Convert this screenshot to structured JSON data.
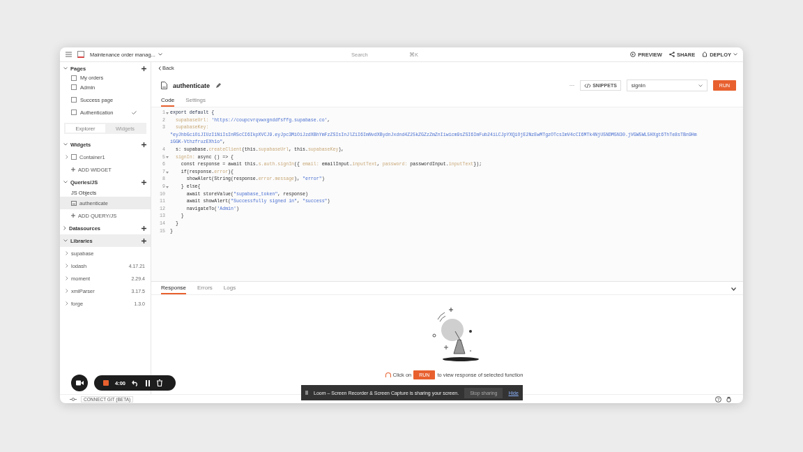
{
  "header": {
    "app_name": "Maintenance order manag...",
    "search_placeholder": "Search",
    "search_shortcut": "⌘K",
    "actions": [
      {
        "label": "PREVIEW",
        "kind": "preview"
      },
      {
        "label": "SHARE",
        "kind": "share"
      },
      {
        "label": "DEPLOY",
        "kind": "deploy"
      }
    ]
  },
  "sidebar": {
    "pages_title": "Pages",
    "pages": [
      {
        "label": "My orders",
        "checked": false
      },
      {
        "label": "Admin",
        "checked": false
      },
      {
        "label": "Success page",
        "checked": false
      },
      {
        "label": "Authentication",
        "checked": true
      }
    ],
    "toggle": [
      {
        "label": "Explorer",
        "selected": true
      },
      {
        "label": "Widgets",
        "selected": false
      }
    ],
    "sections": [
      {
        "title": "Widgets",
        "expanded": true,
        "hovered": false,
        "items": [
          {
            "label": "Container1",
            "kind": "widget",
            "selected": false
          },
          {
            "label": "ADD WIDGET",
            "kind": "add",
            "selected": false
          }
        ]
      },
      {
        "title": "Queries/JS",
        "expanded": true,
        "hovered": false,
        "items": [
          {
            "label": "JS Objects",
            "kind": "group",
            "selected": false
          },
          {
            "label": "authenticate",
            "kind": "js",
            "selected": true
          },
          {
            "label": "ADD QUERY/JS",
            "kind": "add",
            "selected": false
          }
        ]
      },
      {
        "title": "Datasources",
        "expanded": false,
        "hovered": false
      },
      {
        "title": "Libraries",
        "expanded": true,
        "hovered": true,
        "items": [
          {
            "label": "supabase",
            "kind": "lib",
            "selected": false
          },
          {
            "label": "lodash",
            "version": "4.17.21",
            "kind": "lib",
            "selected": false
          },
          {
            "label": "moment",
            "version": "2.29.4",
            "kind": "lib",
            "selected": false
          },
          {
            "label": "xmlParser",
            "version": "3.17.5",
            "kind": "lib",
            "selected": false
          },
          {
            "label": "forge",
            "version": "1.3.0",
            "kind": "lib",
            "selected": false
          }
        ]
      }
    ]
  },
  "editor": {
    "back": "Back",
    "name": "authenticate",
    "more": "···",
    "snippets": "SNIPPETS",
    "function": "signIn",
    "run": "RUN",
    "tabs": [
      {
        "label": "Code",
        "selected": true
      },
      {
        "label": "Settings",
        "selected": false
      }
    ],
    "lines": [
      {
        "no": "1",
        "fold": true,
        "segments": [
          {
            "text": "export default {",
            "kind": "keyword"
          }
        ]
      },
      {
        "no": "2",
        "fold": false,
        "segments": [
          {
            "text": "  supabaseUrl: ",
            "kind": "prop"
          },
          {
            "text": "'https://coupcvrqvwxgnddfsffg.supabase.co'",
            "kind": "string"
          },
          {
            "text": ",",
            "kind": "plain"
          }
        ]
      },
      {
        "no": "3",
        "fold": false,
        "segments": [
          {
            "text": "  supabaseKey:",
            "kind": "prop"
          }
        ]
      },
      {
        "fold": false,
        "segments": [
          {
            "text": "\"eyJhbGciOiJIUzI1NiIsInR5cCI6IkpXVCJ9.eyJpc3MiOiJzdXBhYmFzZSIsInJlZiI6ImNvdXBydnJxdnd4Z25kZGZzZmZnIiwicm9sZSI6ImFub24iLCJpYXQiOjE2NzEwMTgzOTcsImV4cCI6MTk4NjU5NDM5N30.jVGW5WL5HXgt6ThTe8sTBn9Hm",
            "kind": "string"
          }
        ]
      },
      {
        "fold": false,
        "segments": [
          {
            "text": "iGGK-VthzfruzEXh1o\"",
            "kind": "string"
          },
          {
            "text": ",",
            "kind": "plain"
          }
        ]
      },
      {
        "no": "4",
        "fold": false,
        "segments": [
          {
            "text": "  s: supabase.",
            "kind": "plain"
          },
          {
            "text": "createClient",
            "kind": "prop"
          },
          {
            "text": "(this.",
            "kind": "plain"
          },
          {
            "text": "supabaseUrl",
            "kind": "prop"
          },
          {
            "text": ", this.",
            "kind": "plain"
          },
          {
            "text": "supabaseKey",
            "kind": "prop"
          },
          {
            "text": "),",
            "kind": "plain"
          }
        ]
      },
      {
        "no": "5",
        "fold": true,
        "segments": [
          {
            "text": "  signIn: ",
            "kind": "prop"
          },
          {
            "text": "async () => {",
            "kind": "plain"
          }
        ]
      },
      {
        "no": "6",
        "fold": false,
        "segments": [
          {
            "text": "    const response = await this.",
            "kind": "plain"
          },
          {
            "text": "s.auth.signIn",
            "kind": "prop"
          },
          {
            "text": "({ ",
            "kind": "plain"
          },
          {
            "text": "email: ",
            "kind": "prop"
          },
          {
            "text": "emailInput.",
            "kind": "plain"
          },
          {
            "text": "inputText",
            "kind": "prop"
          },
          {
            "text": ", ",
            "kind": "plain"
          },
          {
            "text": "password: ",
            "kind": "prop"
          },
          {
            "text": "passwordInput.",
            "kind": "plain"
          },
          {
            "text": "inputText",
            "kind": "prop"
          },
          {
            "text": "});",
            "kind": "plain"
          }
        ]
      },
      {
        "no": "7",
        "fold": true,
        "segments": [
          {
            "text": "    if(response.",
            "kind": "plain"
          },
          {
            "text": "error",
            "kind": "prop"
          },
          {
            "text": "){",
            "kind": "plain"
          }
        ]
      },
      {
        "no": "8",
        "fold": false,
        "segments": [
          {
            "text": "      showAlert(String(response.",
            "kind": "plain"
          },
          {
            "text": "error.message",
            "kind": "prop"
          },
          {
            "text": "), ",
            "kind": "plain"
          },
          {
            "text": "\"error\"",
            "kind": "string"
          },
          {
            "text": ")",
            "kind": "plain"
          }
        ]
      },
      {
        "no": "9",
        "fold": true,
        "segments": [
          {
            "text": "    } else{",
            "kind": "plain"
          }
        ]
      },
      {
        "no": "10",
        "fold": false,
        "segments": [
          {
            "text": "      await storeValue(",
            "kind": "plain"
          },
          {
            "text": "\"supabase_token\"",
            "kind": "string"
          },
          {
            "text": ", response)",
            "kind": "plain"
          }
        ]
      },
      {
        "no": "11",
        "fold": false,
        "segments": [
          {
            "text": "      await showAlert(",
            "kind": "plain"
          },
          {
            "text": "\"Successfully signed in\"",
            "kind": "string"
          },
          {
            "text": ", ",
            "kind": "plain"
          },
          {
            "text": "\"success\"",
            "kind": "string"
          },
          {
            "text": ")",
            "kind": "plain"
          }
        ]
      },
      {
        "no": "12",
        "fold": false,
        "segments": [
          {
            "text": "      navigateTo(",
            "kind": "plain"
          },
          {
            "text": "'Admin'",
            "kind": "string"
          },
          {
            "text": ")",
            "kind": "plain"
          }
        ]
      },
      {
        "no": "13",
        "fold": false,
        "segments": [
          {
            "text": "    }",
            "kind": "plain"
          }
        ]
      },
      {
        "no": "14",
        "fold": false,
        "segments": [
          {
            "text": "  }",
            "kind": "plain"
          }
        ]
      },
      {
        "no": "15",
        "fold": false,
        "segments": [
          {
            "text": "}",
            "kind": "plain"
          }
        ]
      }
    ]
  },
  "response_panel": {
    "tabs": [
      {
        "label": "Response",
        "selected": true
      },
      {
        "label": "Errors",
        "selected": false
      },
      {
        "label": "Logs",
        "selected": false
      }
    ],
    "hint_before": "Click on",
    "hint_button": "RUN",
    "hint_after": "to view response of selected function"
  },
  "bottom_bar": {
    "git": "CONNECT GIT (BETA)",
    "help": "?"
  },
  "recorder": {
    "time": "4:00"
  },
  "loom_banner": {
    "message": "Loom – Screen Recorder & Screen Capture is sharing your screen.",
    "stop": "Stop sharing",
    "hide": "Hide"
  }
}
